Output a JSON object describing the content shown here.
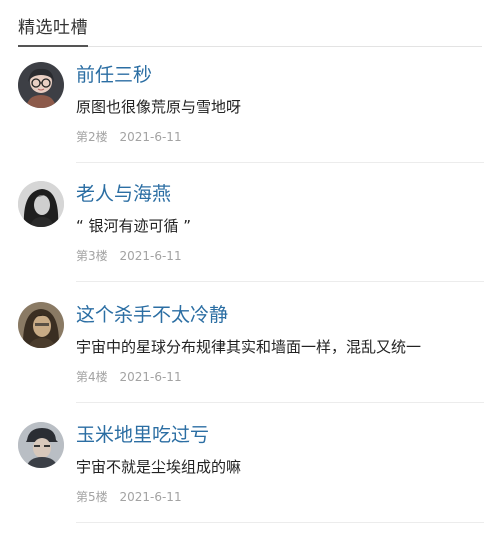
{
  "section": {
    "title": "精选吐槽"
  },
  "comments": [
    {
      "avatar_icon": "avatar-cartoon-girl-glasses",
      "username": "前任三秒",
      "text": "原图也很像荒原与雪地呀",
      "floor": "第2楼",
      "date": "2021-6-11"
    },
    {
      "avatar_icon": "avatar-dark-hair-portrait",
      "username": "老人与海燕",
      "text": "“ 银河有迹可循 ”",
      "floor": "第3楼",
      "date": "2021-6-11"
    },
    {
      "avatar_icon": "avatar-sepia-portrait",
      "username": "这个杀手不太冷静",
      "text": "宇宙中的星球分布规律其实和墙面一样，混乱又统一",
      "floor": "第4楼",
      "date": "2021-6-11"
    },
    {
      "avatar_icon": "avatar-cap-boy",
      "username": "玉米地里吃过亏",
      "text": "宇宙不就是尘埃组成的嘛",
      "floor": "第5楼",
      "date": "2021-6-11"
    }
  ],
  "colors": {
    "username": "#2b6ea3",
    "meta": "#a3a3a3",
    "text": "#222222"
  }
}
